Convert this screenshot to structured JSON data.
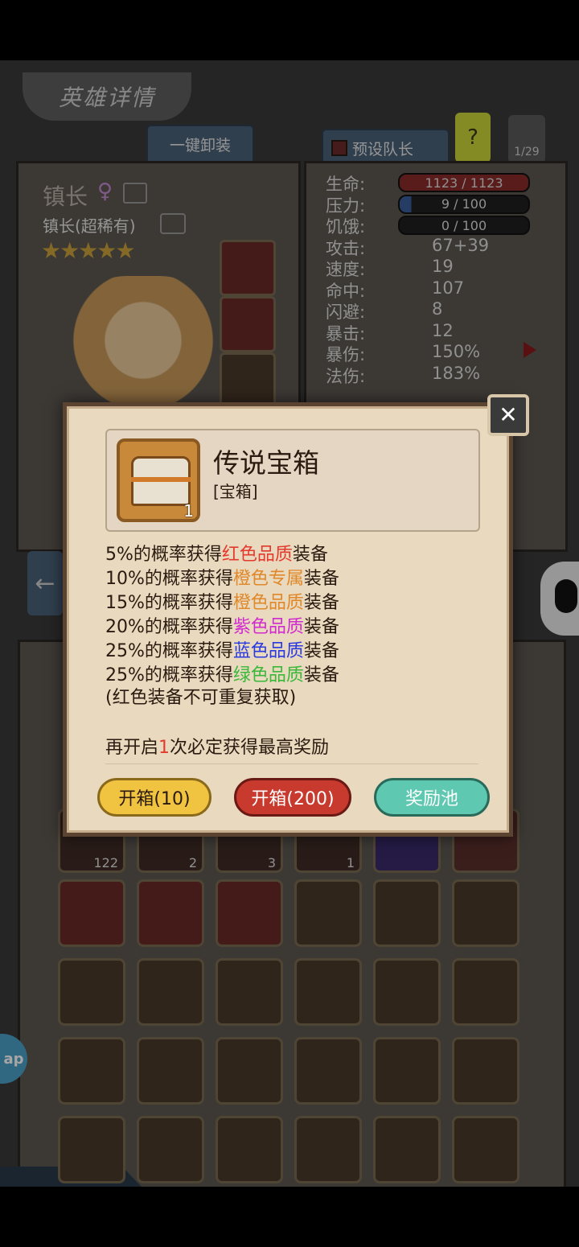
{
  "header": {
    "title": "英雄详情"
  },
  "tabs": {
    "unequip_all": "一键卸装",
    "preset_leader": "预设队长",
    "help": "?",
    "page": "1/29"
  },
  "hero": {
    "name": "镇长",
    "gender_symbol": "♀",
    "class": "镇长(超稀有)",
    "stars": 5
  },
  "stats": [
    {
      "label": "生命:",
      "value": "1123 / 1123",
      "bar_color": "#8a2a2a",
      "fill": 1.0
    },
    {
      "label": "压力:",
      "value": "9 / 100",
      "bar_color": "#3a5f9a",
      "fill": 0.09
    },
    {
      "label": "饥饿:",
      "value": "0 / 100",
      "bar_color": "#2a2a2a",
      "fill": 0.0
    },
    {
      "label": "攻击:",
      "value": "67+39"
    },
    {
      "label": "速度:",
      "value": "19"
    },
    {
      "label": "命中:",
      "value": "107"
    },
    {
      "label": "闪避:",
      "value": "8"
    },
    {
      "label": "暴击:",
      "value": "12"
    },
    {
      "label": "暴伤:",
      "value": "150%"
    },
    {
      "label": "法伤:",
      "value": "183%"
    }
  ],
  "inventory_counts": [
    "122",
    "2",
    "3",
    "1"
  ],
  "modal": {
    "item_name": "传说宝箱",
    "item_type": "[宝箱]",
    "item_count": "1",
    "probabilities": [
      {
        "prefix": "5%的概率获得",
        "quality": "红色品质",
        "suffix": "装备",
        "color": "#e43a2e"
      },
      {
        "prefix": "10%的概率获得",
        "quality": "橙色专属",
        "suffix": "装备",
        "color": "#e0882a"
      },
      {
        "prefix": "15%的概率获得",
        "quality": "橙色品质",
        "suffix": "装备",
        "color": "#e0882a"
      },
      {
        "prefix": "20%的概率获得",
        "quality": "紫色品质",
        "suffix": "装备",
        "color": "#d02ad0"
      },
      {
        "prefix": "25%的概率获得",
        "quality": "蓝色品质",
        "suffix": "装备",
        "color": "#2a3ae0"
      },
      {
        "prefix": "25%的概率获得",
        "quality": "绿色品质",
        "suffix": "装备",
        "color": "#3ab83a"
      }
    ],
    "note": "(红色装备不可重复获取)",
    "pity": {
      "before": "再开启",
      "count": "1",
      "after": "次必定获得最高奖励",
      "count_color": "#e43a2e"
    },
    "buttons": {
      "open_10": "开箱(10)",
      "open_200": "开箱(200)",
      "reward_pool": "奖励池"
    }
  },
  "side_bubble": "ap"
}
